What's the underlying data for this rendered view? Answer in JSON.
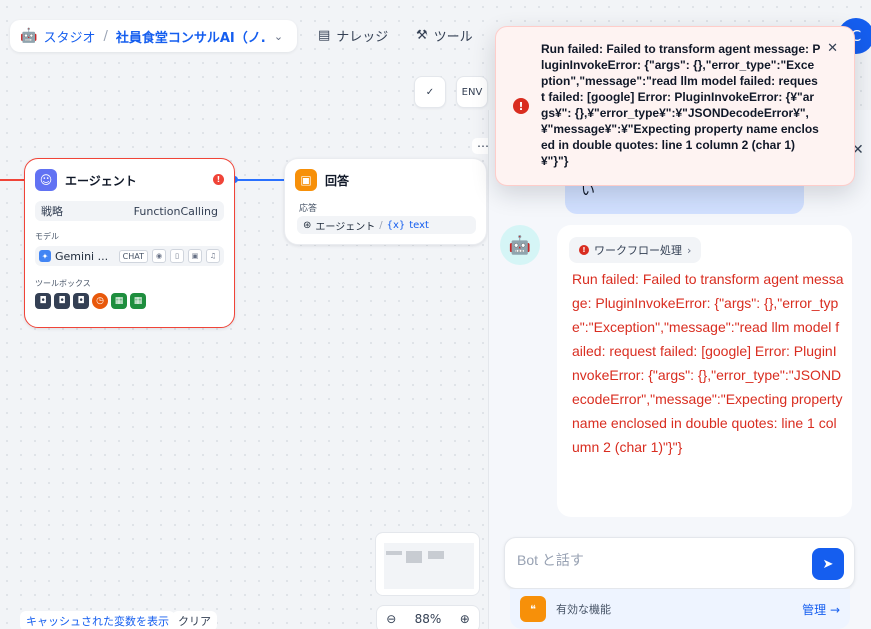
{
  "nav": {
    "studio_label": "スタジオ",
    "app_name": "社員食堂コンサルAI（ノ...",
    "knowledge_label": "ナレッジ",
    "tools_label": "ツール",
    "avatar_letter": "C"
  },
  "toolbar": {
    "checklist_label": "✓",
    "env_label": "ENV"
  },
  "agent_node": {
    "title": "エージェント",
    "strategy_label": "戦略",
    "strategy_value": "FunctionCalling",
    "model_label": "モデル",
    "model_name": "Gemini ...",
    "model_badge": "CHAT",
    "toolbox_label": "ツールボックス"
  },
  "answer_node": {
    "title": "回答",
    "response_label": "応答",
    "var_source": "エージェント",
    "var_name": "text"
  },
  "canvas": {
    "cache_button": "キャッシュされた変数を表示",
    "clear_button": "クリア",
    "zoom": "88%"
  },
  "chat": {
    "user_message_fragment": "い",
    "workflow_tag": "ワークフロー処理",
    "bot_error": "Run failed: Failed to transform agent message: PluginInvokeError: {\"args\": {},\"error_type\":\"Exception\",\"message\":\"read llm model failed: request failed: [google] Error: PluginInvokeError: {\"args\": {},\"error_type\":\"JSONDecodeError\",\"message\":\"Expecting property name enclosed in double quotes: line 1 column 2 (char 1)\"}\"}",
    "input_placeholder": "Bot と話す",
    "features_label": "有効な機能",
    "manage_label": "管理 →"
  },
  "toast": {
    "message": "Run failed: Failed to transform agent message: PluginInvokeError: {\"args\": {},\"error_type\":\"Exception\",\"message\":\"read llm model failed: request failed: [google] Error: PluginInvokeError: {¥\"args¥\": {},¥\"error_type¥\":¥\"JSONDecodeError¥\",¥\"message¥\":¥\"Expecting property name enclosed in double quotes: line 1 column 2 (char 1)¥\"}\"}"
  },
  "colors": {
    "primary": "#155eef",
    "error": "#d92d20",
    "edge": "#2970ff"
  }
}
